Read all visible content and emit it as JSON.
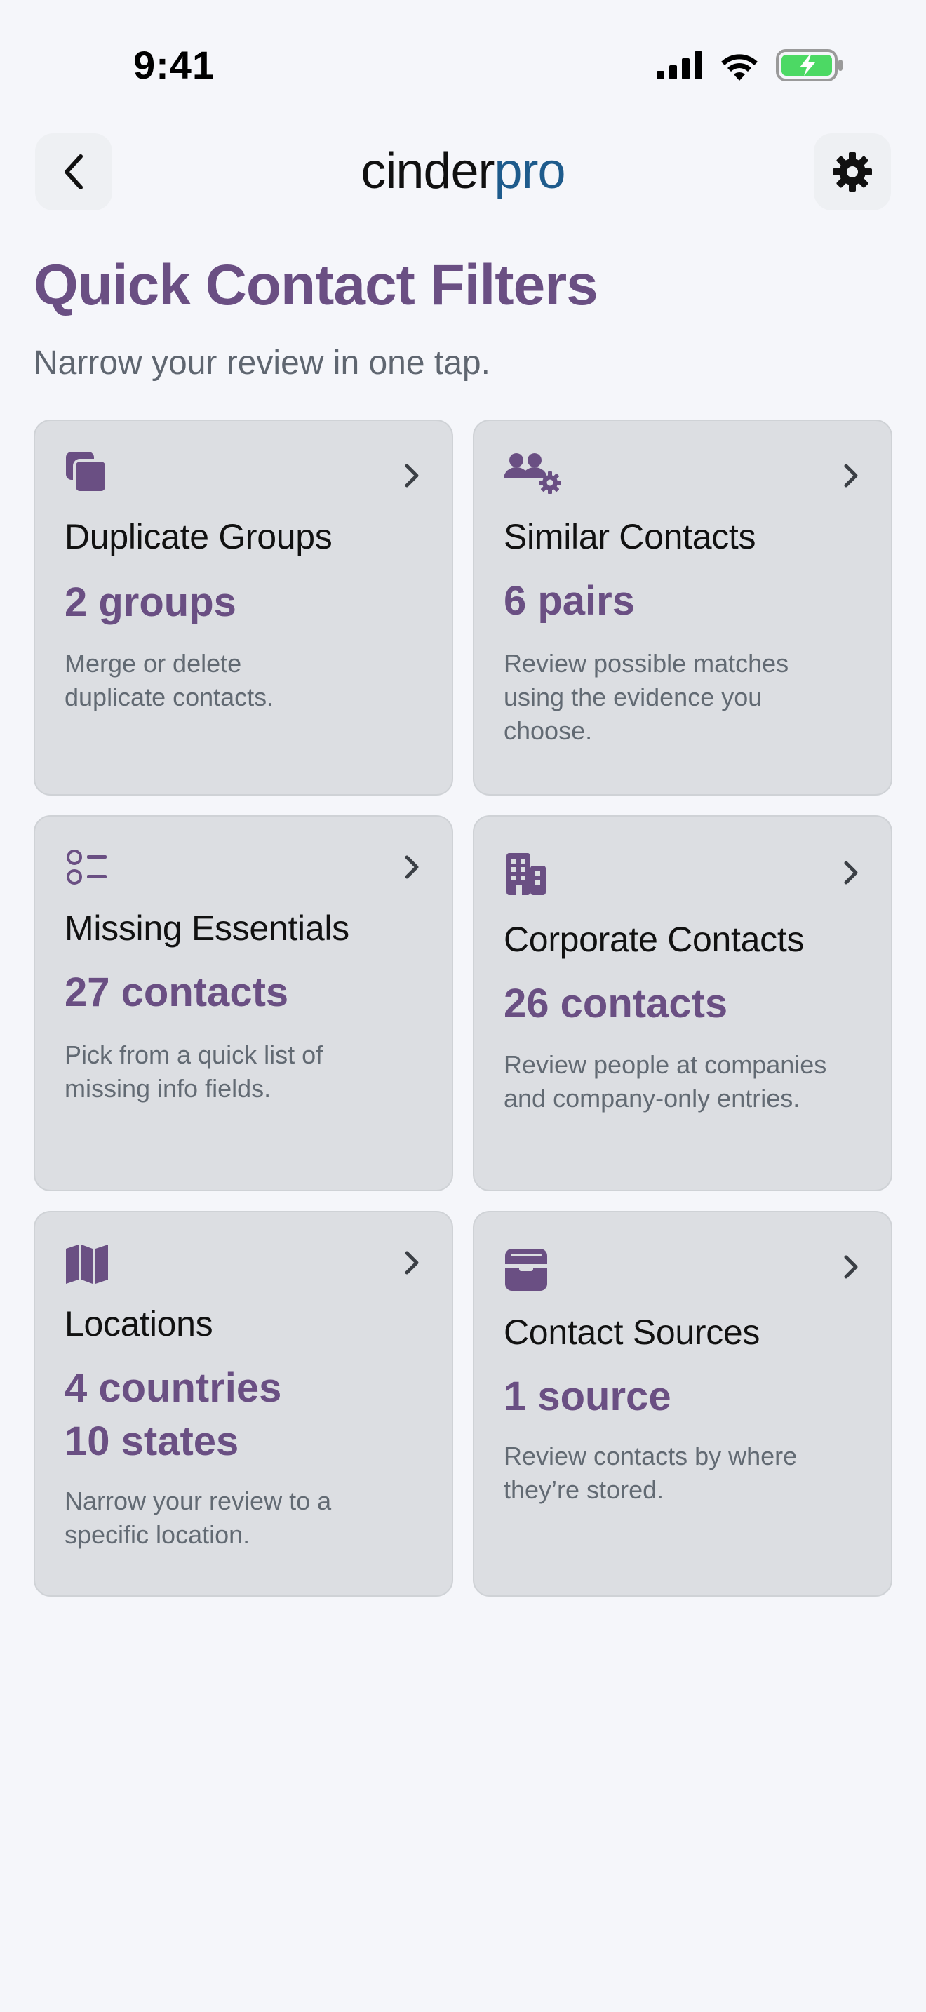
{
  "status_bar": {
    "time": "9:41"
  },
  "nav": {
    "logo_part1": "cinder",
    "logo_part2": "pro"
  },
  "page": {
    "title": "Quick Contact Filters",
    "subtitle": "Narrow your review in one tap."
  },
  "cards": [
    {
      "icon": "copy-icon",
      "title": "Duplicate Groups",
      "value": "2 groups",
      "description": "Merge or delete duplicate contacts."
    },
    {
      "icon": "users-gear-icon",
      "title": "Similar Contacts",
      "value": "6 pairs",
      "description": "Review possible matches using the evidence you choose."
    },
    {
      "icon": "list-icon",
      "title": "Missing Essentials",
      "value": "27 contacts",
      "description": "Pick from a quick list of missing info fields."
    },
    {
      "icon": "building-icon",
      "title": "Corporate Contacts",
      "value": "26 contacts",
      "description": "Review people at companies and company-only entries."
    },
    {
      "icon": "map-icon",
      "title": "Locations",
      "value": "4 countries",
      "value2": "10 states",
      "description": "Narrow your review to a specific location."
    },
    {
      "icon": "inbox-icon",
      "title": "Contact Sources",
      "value": "1 source",
      "description": "Review contacts by where they’re stored."
    }
  ],
  "colors": {
    "accent": "#6a4f83",
    "logo_blue": "#1e5b8c",
    "card_bg": "#dcdee2",
    "page_bg": "#f5f6fa",
    "battery_green": "#4cd964"
  }
}
